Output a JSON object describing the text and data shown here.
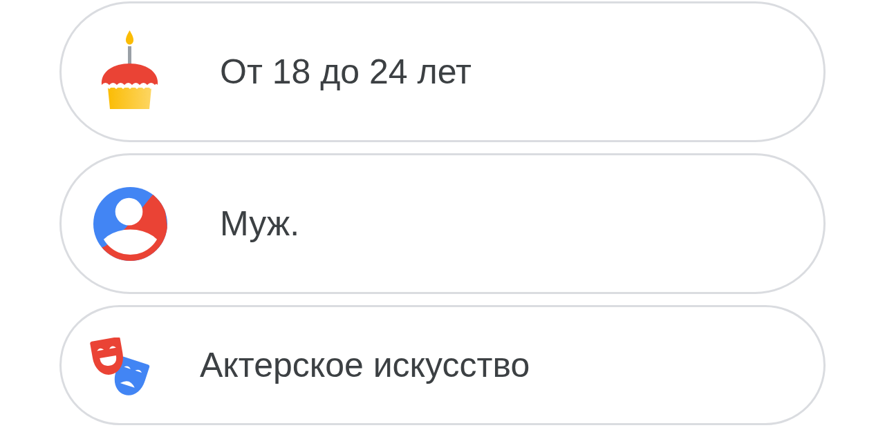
{
  "items": [
    {
      "kind": "cake",
      "label": "От 18 до 24 лет"
    },
    {
      "kind": "person",
      "label": "Муж."
    },
    {
      "kind": "masks",
      "label": "Актерское искусство"
    }
  ]
}
